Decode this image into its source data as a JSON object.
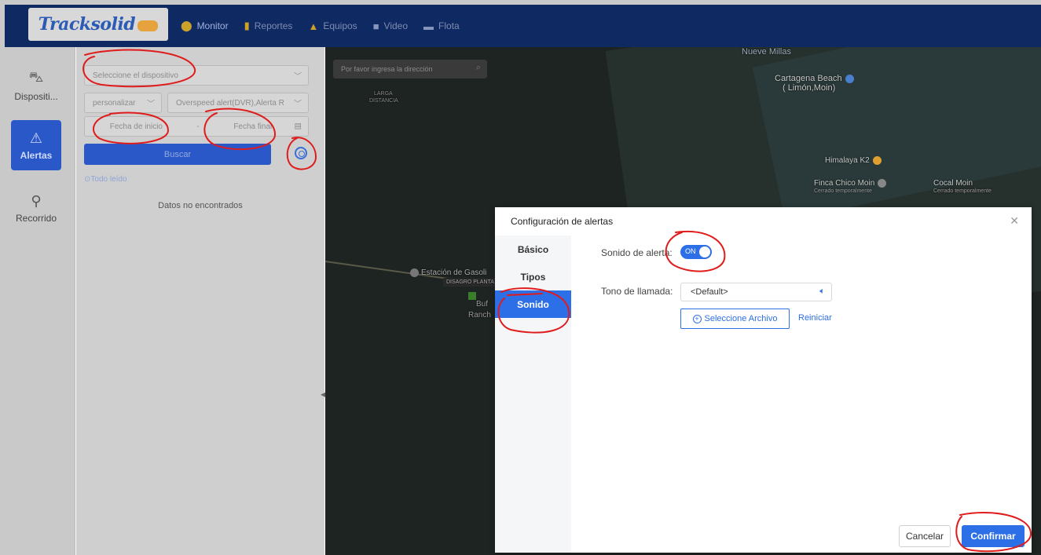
{
  "brand": {
    "logo_text": "Tracksolid"
  },
  "nav": [
    {
      "label": "Monitor",
      "icon": "map-pin-icon"
    },
    {
      "label": "Reportes",
      "icon": "bar-chart-icon"
    },
    {
      "label": "Equipos",
      "icon": "car-icon"
    },
    {
      "label": "Video",
      "icon": "video-icon"
    },
    {
      "label": "Flota",
      "icon": "fleet-icon"
    }
  ],
  "leftbar": {
    "devices": "Dispositi...",
    "alerts": "Alertas",
    "route": "Recorrido"
  },
  "panel": {
    "device_placeholder": "Seleccione el dispositivo",
    "mode": "personalizar",
    "alert_types": "Overspeed alert(DVR),Alerta R",
    "start_date": "Fecha de inicio",
    "date_sep": "-",
    "end_date": "Fecha final",
    "search": "Buscar",
    "mark_all_read": "Todo leído",
    "no_data": "Datos no encontrados"
  },
  "map": {
    "search_placeholder": "Por favor ingresa la dirección",
    "labels": {
      "larga": "LARGA",
      "distancia": "DISTANCIA",
      "nueve_millas": "Nueve Millas",
      "cartagena_1": "Cartagena Beach",
      "cartagena_2": "( Limón,Moin)",
      "himalaya": "Himalaya K2",
      "finca": "Finca Chico Moin",
      "finca_note": "Cerrado temporalmente",
      "cocal": "Cocal Moin",
      "cocal_note": "Cerrado temporalmente",
      "estacion": "Estación de Gasoli",
      "disagro": "DISAGRO PLANTA",
      "buf": "Buf",
      "ranch": "Ranch"
    }
  },
  "dialog": {
    "title": "Configuración de alertas",
    "tabs": [
      "Básico",
      "Tipos",
      "Sonido"
    ],
    "active_tab": "Sonido",
    "sound_label": "Sonido de alerta:",
    "sound_switch": "ON",
    "ringtone_label": "Tono de llamada:",
    "ringtone_value": "<Default>",
    "select_file": "Seleccione Archivo",
    "reset": "Reiniciar",
    "cancel": "Cancelar",
    "confirm": "Confirmar"
  },
  "colors": {
    "accent": "#2d6fe6",
    "nav_bg": "#0f2a63",
    "annotation": "#e01b1b"
  }
}
